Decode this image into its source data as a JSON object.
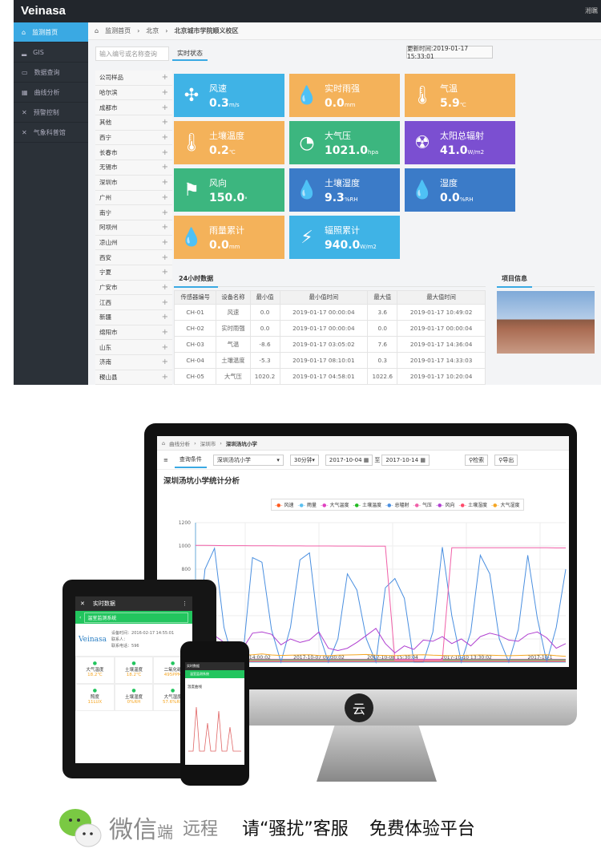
{
  "app": {
    "logo": "Veinasa",
    "user": "湘瞩"
  },
  "sidebar": {
    "items": [
      {
        "label": "监测首页",
        "icon": "home-icon",
        "active": true
      },
      {
        "label": "GIS",
        "icon": "signal-icon"
      },
      {
        "label": "数据查询",
        "icon": "inbox-icon"
      },
      {
        "label": "曲线分析",
        "icon": "chart-icon"
      },
      {
        "label": "预警控制",
        "icon": "tools-icon"
      },
      {
        "label": "气象科普馆",
        "icon": "tools-icon"
      }
    ]
  },
  "breadcrumb": [
    "监测首页",
    "北京",
    "北京城市学院顺义校区"
  ],
  "search": {
    "placeholder": "输入编号或名称查询"
  },
  "tab_realtime": "实时状态",
  "update_time": "更新时间:2019-01-17 15:33:01",
  "stations": [
    "公司样品",
    "哈尔滨",
    "成都市",
    "其他",
    "西宁",
    "长春市",
    "无锡市",
    "深圳市",
    "广州",
    "南宁",
    "阿坝州",
    "凉山州",
    "西安",
    "宁夏",
    "广安市",
    "江西",
    "新疆",
    "绵阳市",
    "山东",
    "济南",
    "稷山县"
  ],
  "tiles": [
    {
      "name": "风速",
      "value": "0.3",
      "unit": "m/s",
      "icon": "fan-icon",
      "color": "#3fb3e6"
    },
    {
      "name": "实时雨强",
      "value": "0.0",
      "unit": "mm",
      "icon": "raindrops-icon",
      "color": "#f4b25a"
    },
    {
      "name": "气温",
      "value": "5.9",
      "unit": "℃",
      "icon": "thermometer-icon",
      "color": "#f4b25a"
    },
    {
      "name": "土壤温度",
      "value": "0.2",
      "unit": "℃",
      "icon": "thermometer-icon",
      "color": "#f4b25a"
    },
    {
      "name": "大气压",
      "value": "1021.0",
      "unit": "hpa",
      "icon": "gauge-icon",
      "color": "#3cb67f"
    },
    {
      "name": "太阳总辐射",
      "value": "41.0",
      "unit": "W/m2",
      "icon": "radiation-icon",
      "color": "#7b4fd1"
    },
    {
      "name": "风向",
      "value": "150.0",
      "unit": "°",
      "icon": "windsock-icon",
      "color": "#3cb67f"
    },
    {
      "name": "土壤湿度",
      "value": "9.3",
      "unit": "%RH",
      "icon": "drop-icon",
      "color": "#3b7bc8"
    },
    {
      "name": "湿度",
      "value": "0.0",
      "unit": "%RH",
      "icon": "drop-icon",
      "color": "#3b7bc8"
    },
    {
      "name": "雨量累计",
      "value": "0.0",
      "unit": "mm",
      "icon": "raindrops-icon",
      "color": "#f4b25a"
    },
    {
      "name": "辐照累计",
      "value": "940.0",
      "unit": "W/m2",
      "icon": "lightning-icon",
      "color": "#3fb3e6"
    }
  ],
  "table": {
    "title": "24小时数据",
    "headers": [
      "传感器编号",
      "设备名称",
      "最小值",
      "最小值时间",
      "最大值",
      "最大值时间"
    ],
    "rows": [
      [
        "CH-01",
        "风速",
        "0.0",
        "2019-01-17 00:00:04",
        "3.6",
        "2019-01-17 10:49:02"
      ],
      [
        "CH-02",
        "实时雨强",
        "0.0",
        "2019-01-17 00:00:04",
        "0.0",
        "2019-01-17 00:00:04"
      ],
      [
        "CH-03",
        "气温",
        "-8.6",
        "2019-01-17 03:05:02",
        "7.6",
        "2019-01-17 14:36:04"
      ],
      [
        "CH-04",
        "土壤温度",
        "-5.3",
        "2019-01-17 08:10:01",
        "0.3",
        "2019-01-17 14:33:03"
      ],
      [
        "CH-05",
        "大气压",
        "1020.2",
        "2019-01-17 04:58:01",
        "1022.6",
        "2019-01-17 10:20:04"
      ]
    ]
  },
  "project_info": "项目信息",
  "monitor": {
    "breadcrumb": [
      "曲线分析",
      "深圳市",
      "深圳汤坑小学"
    ],
    "query_tab": "查询条件",
    "station": "深圳汤坑小学",
    "interval": "30分钟",
    "date_from": "2017-10-04",
    "to": "至",
    "date_to": "2017-10-14",
    "search_btn": "检索",
    "export_btn": "导出",
    "chart_title": "深圳汤坑小学统计分析",
    "logo_glyph": "云"
  },
  "chart_data": {
    "type": "line",
    "title": "深圳汤坑小学统计分析",
    "ylim": [
      0,
      1200
    ],
    "yticks": [
      1200,
      1000,
      800
    ],
    "xticks": [
      "2017-10-05 14:00:02",
      "2017-10-07 09:30:02",
      "2017-10-08 15:30:04",
      "2017-10-10 13:30:02",
      "2017-10-1"
    ],
    "legend_position": "top",
    "grid": true,
    "series": [
      {
        "name": "风速",
        "color": "#ff5a1f",
        "values": [
          5,
          5,
          5,
          5,
          5,
          5,
          5,
          5,
          5,
          5,
          5,
          5,
          5,
          5,
          5,
          5,
          5,
          5,
          5,
          5,
          5,
          5,
          5,
          5,
          5,
          5,
          5,
          5,
          5,
          5,
          5,
          5,
          5,
          5,
          5,
          5,
          5,
          5,
          5,
          5
        ]
      },
      {
        "name": "雨量",
        "color": "#5bc0f0",
        "values": [
          0,
          0,
          0,
          0,
          0,
          0,
          0,
          0,
          0,
          0,
          0,
          0,
          0,
          0,
          0,
          0,
          0,
          0,
          0,
          0,
          0,
          0,
          0,
          0,
          0,
          0,
          0,
          0,
          0,
          0,
          0,
          0,
          0,
          0,
          0,
          0,
          0,
          0,
          0,
          0
        ]
      },
      {
        "name": "大气温度",
        "color": "#e040c0",
        "values": [
          25,
          25,
          25,
          25,
          25,
          25,
          25,
          25,
          25,
          25,
          25,
          25,
          25,
          25,
          25,
          25,
          25,
          25,
          25,
          25,
          25,
          25,
          25,
          25,
          25,
          25,
          25,
          25,
          25,
          25,
          25,
          25,
          25,
          25,
          25,
          25,
          25,
          25,
          25,
          25
        ]
      },
      {
        "name": "土壤温度",
        "color": "#22bb22",
        "values": [
          20,
          20,
          20,
          20,
          20,
          20,
          20,
          20,
          20,
          20,
          20,
          20,
          20,
          20,
          20,
          20,
          20,
          20,
          20,
          20,
          20,
          20,
          20,
          20,
          20,
          20,
          20,
          20,
          20,
          20,
          20,
          20,
          20,
          20,
          20,
          20,
          20,
          20,
          20,
          20
        ]
      },
      {
        "name": "总辐射",
        "color": "#4a8fe0",
        "values": [
          0,
          800,
          980,
          300,
          0,
          60,
          900,
          860,
          280,
          0,
          300,
          880,
          940,
          250,
          0,
          200,
          760,
          620,
          200,
          0,
          640,
          720,
          550,
          0,
          0,
          260,
          990,
          400,
          0,
          260,
          920,
          760,
          200,
          0,
          280,
          920,
          380,
          0,
          300,
          800
        ]
      },
      {
        "name": "气压",
        "color": "#f060a8",
        "values": [
          1005,
          1005,
          1004,
          1003,
          1003,
          1003,
          1002,
          1002,
          1002,
          1001,
          1001,
          1001,
          1000,
          1000,
          1000,
          999,
          999,
          999,
          998,
          998,
          998,
          20,
          20,
          20,
          20,
          20,
          20,
          985,
          985,
          985,
          985,
          985,
          984,
          984,
          984,
          984,
          984,
          984,
          983,
          983
        ]
      },
      {
        "name": "风向",
        "color": "#b040d0",
        "values": [
          150,
          200,
          230,
          170,
          160,
          120,
          250,
          260,
          240,
          150,
          200,
          170,
          190,
          260,
          120,
          100,
          120,
          170,
          230,
          290,
          160,
          80,
          140,
          110,
          190,
          180,
          220,
          160,
          200,
          140,
          220,
          250,
          230,
          190,
          180,
          240,
          260,
          210,
          120,
          160
        ]
      },
      {
        "name": "土壤湿度",
        "color": "#ff4a6a",
        "values": [
          10,
          10,
          10,
          10,
          10,
          10,
          10,
          10,
          10,
          10,
          10,
          10,
          10,
          10,
          10,
          10,
          10,
          10,
          10,
          10,
          10,
          10,
          10,
          10,
          10,
          10,
          10,
          10,
          10,
          10,
          10,
          10,
          10,
          10,
          10,
          10,
          10,
          10,
          10,
          10
        ]
      },
      {
        "name": "大气湿度",
        "color": "#f5a623",
        "values": [
          70,
          68,
          62,
          60,
          58,
          60,
          64,
          70,
          62,
          58,
          60,
          62,
          64,
          58,
          56,
          60,
          62,
          64,
          66,
          60,
          58,
          56,
          60,
          62,
          64,
          60,
          58,
          56,
          58,
          60,
          62,
          60,
          58,
          56,
          58,
          60,
          62,
          64,
          56,
          50
        ]
      }
    ]
  },
  "tablet": {
    "title": "实时数据",
    "select": "温室监测系统",
    "brand": "Veinasa",
    "info": [
      "设备时间：2016-02-17 14:55:01",
      "联系人：",
      "联系电话：596"
    ],
    "cells": [
      {
        "name": "大气温度",
        "value": "18.2℃"
      },
      {
        "name": "土壤温度",
        "value": "18.2℃"
      },
      {
        "name": "二氧化碳",
        "value": "495PPM"
      },
      {
        "name": "照度",
        "value": "11LUX"
      },
      {
        "name": "土壤湿度",
        "value": "0%RH"
      },
      {
        "name": "大气湿度",
        "value": "57.6%RH"
      }
    ]
  },
  "phone": {
    "title": "实时数据",
    "subtitle": "温室监测系统",
    "chart_label": "温度曲线"
  },
  "footer": {
    "wechat": "微信",
    "suffix": "端",
    "remote": "远程",
    "slogan1": "请“骚扰”客服",
    "slogan2": "免费体验平台"
  }
}
